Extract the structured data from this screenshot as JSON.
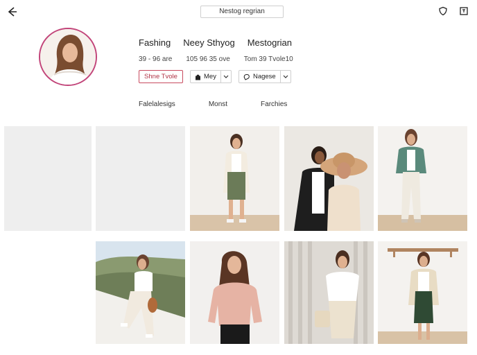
{
  "header": {
    "title": "Nestog regrian",
    "icons": [
      "back-arrow-icon",
      "shield-icon",
      "square-menu-icon"
    ]
  },
  "profile": {
    "stats": [
      "Fashing",
      "Neey Sthyog",
      "Mestogrian"
    ],
    "sub_stats": [
      "39 - 96 are",
      "105 96 35 ove",
      "Tom 39 Tvole10"
    ],
    "primary_button": "Shne Tvole",
    "button_2": "Mey",
    "button_3": "Nagese"
  },
  "tabs": [
    "Falelalesigs",
    "Monst",
    "Farchies"
  ],
  "colors": {
    "accent": "#c2457a",
    "button_border": "#c84a5e",
    "placeholder": "#eeeeee"
  }
}
